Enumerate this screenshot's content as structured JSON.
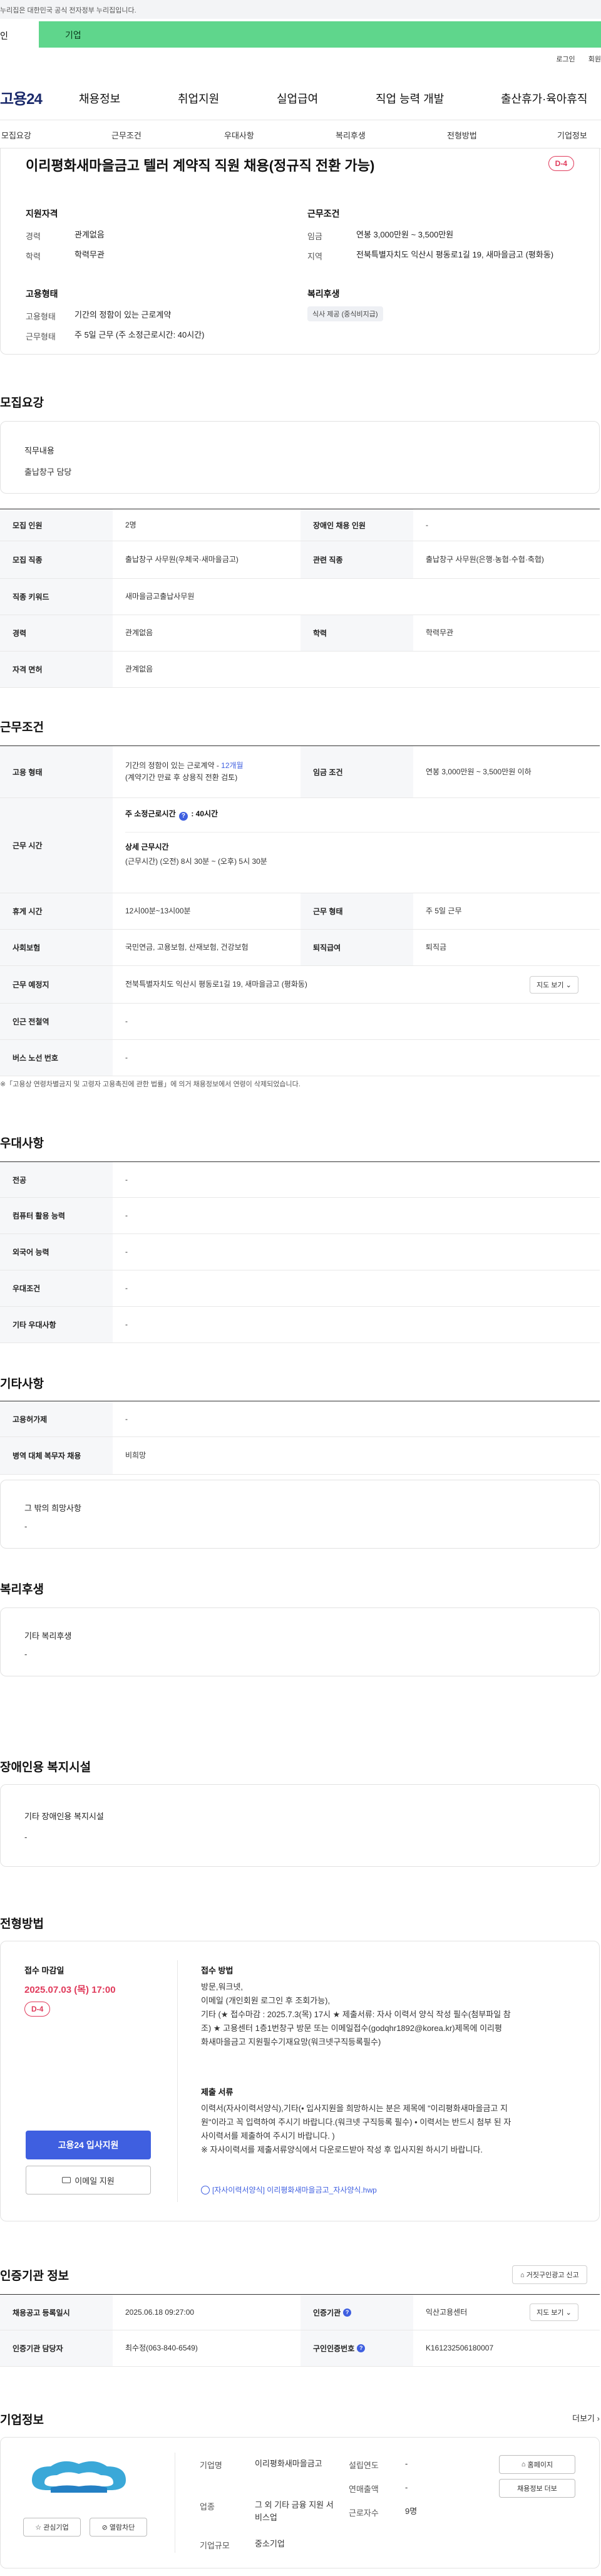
{
  "notice": {
    "text": "이 누리집은 대한민국 공식 전자정부 누리집입니다.",
    "shown": "누리집은 대한민국 공식 전자정부 누리집입니다."
  },
  "tabs": {
    "personal": "인",
    "company": "기업"
  },
  "util": {
    "login": "로그인",
    "signup": "회원"
  },
  "logo": "고용24",
  "gnb": [
    "채용정보",
    "취업지원",
    "실업급여",
    "직업 능력 개발",
    "출산휴가·육아휴직"
  ],
  "subnav": [
    "모집요강",
    "근무조건",
    "우대사항",
    "복리후생",
    "전형방법",
    "기업정보"
  ],
  "summary": {
    "title": "이리평화새마을금고 텔러 계약직 직원 채용(정규직 전환 가능)",
    "dday": "D-4",
    "qual_title": "지원자격",
    "career_label": "경력",
    "career_value": "관계없음",
    "edu_label": "학력",
    "edu_value": "학력무관",
    "cond_title": "근무조건",
    "wage_label": "임금",
    "wage_value": "연봉 3,000만원 ~ 3,500만원",
    "region_label": "지역",
    "region_value": "전북특별자치도 익산시 평동로1길 19, 새마을금고 (평화동)",
    "emp_title": "고용형태",
    "emptype_label": "고용형태",
    "emptype_value": "기간의 정함이 있는 근로계약",
    "worktype_label": "근무형태",
    "worktype_value": "주 5일 근무 (주 소정근로시간: 40시간)",
    "welfare_title": "복리후생",
    "welfare_chip": "식사 제공 (중식비지급)"
  },
  "recruit": {
    "heading": "모집요강",
    "duty_label": "직무내용",
    "duty_value": "출납창구 담당",
    "rows": [
      {
        "l1": "모집 인원",
        "v1": "2명",
        "l2": "장애인 채용 인원",
        "v2": "-"
      },
      {
        "l1": "모집 직종",
        "v1": "출납창구 사무원(우체국·새마을금고)",
        "l2": "관련 직종",
        "v2": "출납창구 사무원(은행·농협·수협·축협)"
      },
      {
        "l1": "직종 키워드",
        "v1": "새마을금고출납사무원"
      },
      {
        "l1": "경력",
        "v1": "관계없음",
        "l2": "학력",
        "v2": "학력무관"
      },
      {
        "l1": "자격 면허",
        "v1": "관계없음"
      }
    ]
  },
  "work": {
    "heading": "근무조건",
    "emp_label": "고용 형태",
    "emp_value1": "기간의 정함이 있는 근로계약 - ",
    "emp_months": "12개월",
    "emp_value2": "(계약기간 만료 후 상용직 전환 검토)",
    "wage_label": "임금 조건",
    "wage_value": "연봉 3,000만원 ~ 3,500만원 이하",
    "time_label": "근무 시간",
    "time_weekly": "주 소정근로시간",
    "time_weekly_value": ": 40시간",
    "time_detail_title": "상세 근무시간",
    "time_detail": "(근무시간) (오전) 8시 30분 ~ (오후) 5시 30분",
    "break_label": "휴게 시간",
    "break_value": "12시00분~13시00분",
    "form_label": "근무 형태",
    "form_value": "주 5일 근무",
    "ins_label": "사회보험",
    "ins_value": "국민연금, 고용보험, 산재보험, 건강보험",
    "retire_label": "퇴직급여",
    "retire_value": "퇴직금",
    "place_label": "근무 예정지",
    "place_value": "전북특별자치도 익산시 평동로1길 19, 새마을금고 (평화동)",
    "map_btn": "지도 보기",
    "subway_label": "인근 전철역",
    "subway_value": "-",
    "bus_label": "버스 노선 번호",
    "bus_value": "-",
    "note": "※「고용상 연령차별금지 및 고령자 고용촉진에 관한 법률」에 의거 채용정보에서 연령이 삭제되었습니다."
  },
  "pref": {
    "heading": "우대사항",
    "rows": [
      {
        "l": "전공",
        "v": "-"
      },
      {
        "l": "컴퓨터 활용 능력",
        "v": "-"
      },
      {
        "l": "외국어 능력",
        "v": "-"
      },
      {
        "l": "우대조건",
        "v": "-"
      },
      {
        "l": "기타 우대사항",
        "v": "-"
      }
    ]
  },
  "etc": {
    "heading": "기타사항",
    "rows": [
      {
        "l": "고용허가제",
        "v": "-"
      },
      {
        "l": "병역 대체 복무자 채용",
        "v": "비희망"
      }
    ],
    "box_label": "그 밖의 희망사항",
    "box_value": "-"
  },
  "welfare": {
    "heading": "복리후생",
    "box_label": "기타 복리후생",
    "box_value": "-"
  },
  "disability": {
    "heading": "장애인용 복지시설",
    "box_label": "기타 장애인용 복지시설",
    "box_value": "-"
  },
  "process": {
    "heading": "전형방법",
    "deadline_label": "접수 마감일",
    "deadline_value": "2025.07.03 (목) 17:00",
    "dday": "D-4",
    "method_title": "접수 방법",
    "method_lines": [
      "방문,워크넷,",
      "이메일 (개인회원 로그인 후 조회가능),",
      "기타 (★ 접수마감 : 2025.7.3(목) 17시 ★ 제출서류: 자사 이력서 양식 작성 필수(첨부파일 참",
      "조)  ★ 고용센터 1층1번창구 방문 또는 이메일접수(godqhr1892@korea.kr)제목에 이리평",
      "화새마을금고 지원필수기재요망(워크넷구직등록필수)"
    ],
    "docs_title": "제출 서류",
    "docs_lines": [
      "이력서(자사이력서양식),기타(• 입사지원을 희망하시는 분은 제목에 \"이리평화새마을금고 지",
      "원\"이라고 꼭 입력하여 주시기 바랍니다.(워크넷 구직등록 필수) • 이력서는 반드시 첨부 된 자",
      "사이력서를 제출하여 주시기 바랍니다. )",
      "※ 자사이력서를 제출서류양식에서 다운로드받아 작성 후 입사지원 하시기 바랍니다."
    ],
    "file_link": "[자사이력서양식] 이리평화새마을금고_자사양식.hwp",
    "apply_btn": "고용24 입사지원",
    "email_btn": "이메일 지원"
  },
  "cert": {
    "heading": "인증기관 정보",
    "report_btn": "거짓구인광고 신고",
    "reg_label": "채용공고 등록일시",
    "reg_value": "2025.06.18 09:27:00",
    "org_label": "인증기관",
    "org_value": "익산고용센터",
    "map_btn": "지도 보기",
    "mgr_label": "인증기관 담당자",
    "mgr_value": "최수정(063-840-6549)",
    "no_label": "구인인증번호",
    "no_value": "K161232506180007"
  },
  "company": {
    "heading": "기업정보",
    "more": "더보기",
    "name_label": "기업명",
    "name_value": "이리평화새마을금고",
    "industry_label": "업종",
    "industry_value": "그 외 기타 금융 지원 서비스업",
    "size_label": "기업규모",
    "size_value": "중소기업",
    "founded_label": "설립연도",
    "founded_value": "-",
    "sales_label": "연매출액",
    "sales_value": "-",
    "staff_label": "근로자수",
    "staff_value": "9명",
    "btn_home": "홈페이지",
    "btn_jobs": "채용정보 더보",
    "btn_fav": "관심기업",
    "btn_block": "열람차단"
  }
}
